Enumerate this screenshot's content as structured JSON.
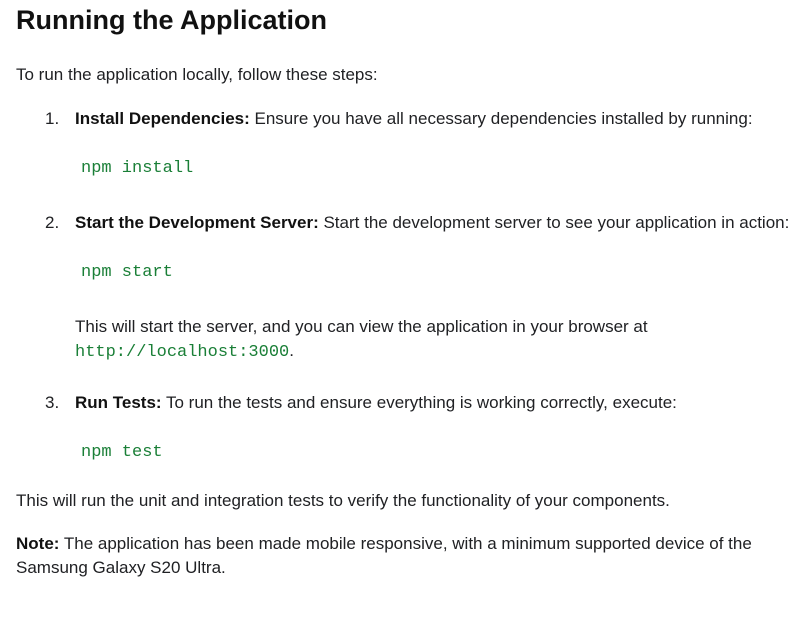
{
  "title": "Running the Application",
  "intro": "To run the application locally, follow these steps:",
  "steps": [
    {
      "number": "1.",
      "heading": "Install Dependencies:",
      "text": " Ensure you have all necessary dependencies installed by running:",
      "code": "npm install"
    },
    {
      "number": "2.",
      "heading": "Start the Development Server:",
      "text": " Start the development server to see your application in action:",
      "code": "npm start",
      "after_text": "This will start the server, and you can view the application in your browser at ",
      "after_code": "http://localhost:3000",
      "after_suffix": "."
    },
    {
      "number": "3.",
      "heading": "Run Tests:",
      "text": " To run the tests and ensure everything is working correctly, execute:",
      "code": "npm test"
    }
  ],
  "summary": "This will run the unit and integration tests to verify the functionality of your components.",
  "note": {
    "label": "Note:",
    "text": " The application has been made mobile responsive, with a minimum supported device of the Samsung Galaxy S20 Ultra."
  }
}
